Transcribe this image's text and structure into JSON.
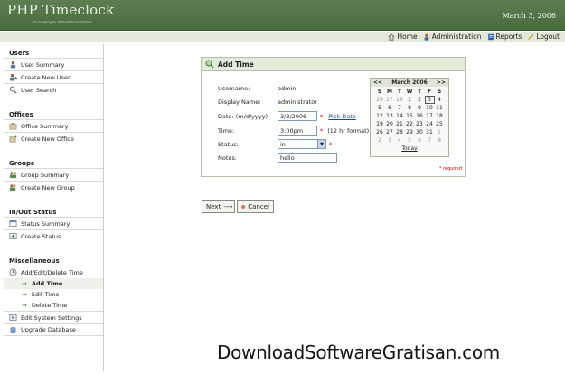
{
  "header": {
    "logo": "PHP Timeclock",
    "tagline": "an employee attendance tracker",
    "date": "March 3, 2006"
  },
  "topnav": {
    "home": "Home",
    "administration": "Administration",
    "reports": "Reports",
    "logout": "Logout"
  },
  "sidebar": {
    "users_title": "Users",
    "user_summary": "User Summary",
    "create_new_user": "Create New User",
    "user_search": "User Search",
    "offices_title": "Offices",
    "office_summary": "Office Summary",
    "create_new_office": "Create New Office",
    "groups_title": "Groups",
    "group_summary": "Group Summary",
    "create_new_group": "Create New Group",
    "inout_title": "In/Out Status",
    "status_summary": "Status Summary",
    "create_status": "Create Status",
    "misc_title": "Miscellaneous",
    "add_edit_delete": "Add/Edit/Delete Time",
    "add_time": "Add Time",
    "edit_time": "Edit Time",
    "delete_time": "Delete Time",
    "edit_system_settings": "Edit System Settings",
    "upgrade_database": "Upgrade Database"
  },
  "panel": {
    "title": "Add Time",
    "username_label": "Username:",
    "username_value": "admin",
    "display_name_label": "Display Name:",
    "display_name_value": "administrator",
    "date_label": "Date: (m/d/yyyy)",
    "date_value": "3/3/2006",
    "pick_date": "Pick Date",
    "time_label": "Time:",
    "time_value": "3:00pm",
    "time_hint": "(12 hr format)",
    "status_label": "Status:",
    "status_value": "in",
    "notes_label": "Notes:",
    "notes_value": "hello",
    "required_note": "* required",
    "asterisk": "*"
  },
  "calendar": {
    "prev": "<<",
    "month": "March 2006",
    "next": ">>",
    "days_of_week": [
      "S",
      "M",
      "T",
      "W",
      "T",
      "F",
      "S"
    ],
    "weeks": [
      [
        "26",
        "27",
        "28",
        "1",
        "2",
        "3",
        "4"
      ],
      [
        "5",
        "6",
        "7",
        "8",
        "9",
        "10",
        "11"
      ],
      [
        "12",
        "13",
        "14",
        "15",
        "16",
        "17",
        "18"
      ],
      [
        "19",
        "20",
        "21",
        "22",
        "23",
        "24",
        "25"
      ],
      [
        "26",
        "27",
        "28",
        "29",
        "30",
        "31",
        "1"
      ],
      [
        "2",
        "3",
        "4",
        "5",
        "6",
        "7",
        "8"
      ]
    ],
    "today_label": "Today"
  },
  "buttons": {
    "next": "Next",
    "cancel": "Cancel"
  },
  "watermark": "DownloadSoftwareGratisan.com",
  "colors": {
    "header": "#4f7345",
    "topnav": "#e2e9d9",
    "required": "#cc0000"
  }
}
